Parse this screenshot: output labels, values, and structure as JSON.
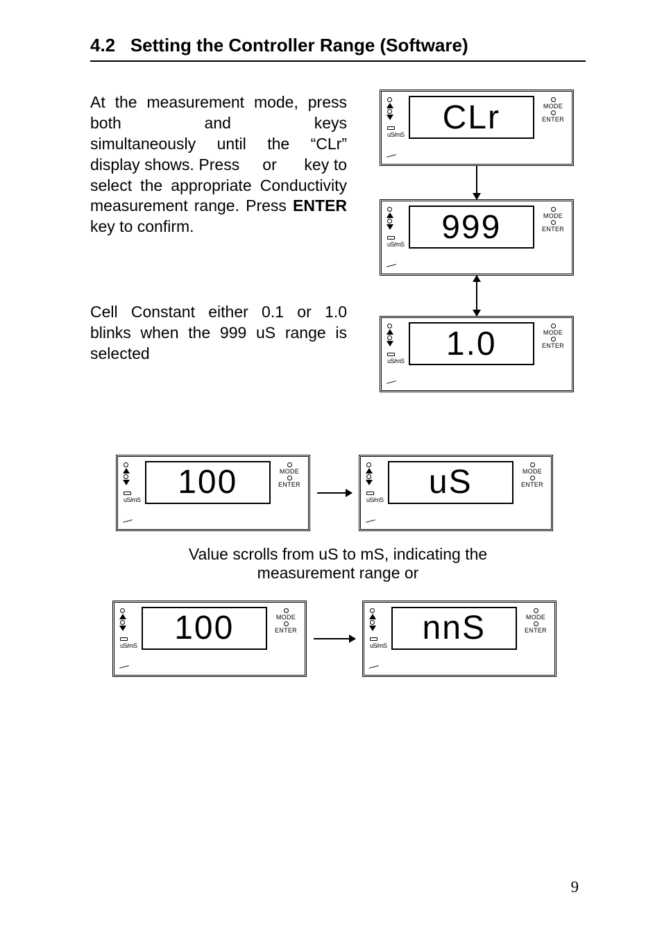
{
  "heading_num": "4.2",
  "heading_text": "Setting the Controller Range (Software)",
  "para1_a": "At the measurement mode, press both",
  "para1_b": "and",
  "para1_c": "keys simultaneously until the “CLr” display shows. Press",
  "para1_d": "or",
  "para1_e": "key to select the appropriate Conductivity measurement range. Press ",
  "enter_word": "ENTER",
  "para1_f": " key to confirm.",
  "para2": "Cell Constant either 0.1 or 1.0 blinks when the 999 uS range is selected",
  "caption": "Value scrolls from uS to mS, indicating the measurement range or",
  "device_usms": "uS/mS",
  "device_mode": "MODE",
  "device_enter": "ENTER",
  "screens": {
    "clr": "CLr",
    "v999": "999",
    "v10": "1.0",
    "v100a": "100",
    "us": "uS",
    "v100b": "100",
    "nns": "nnS"
  },
  "pagenum": "9"
}
